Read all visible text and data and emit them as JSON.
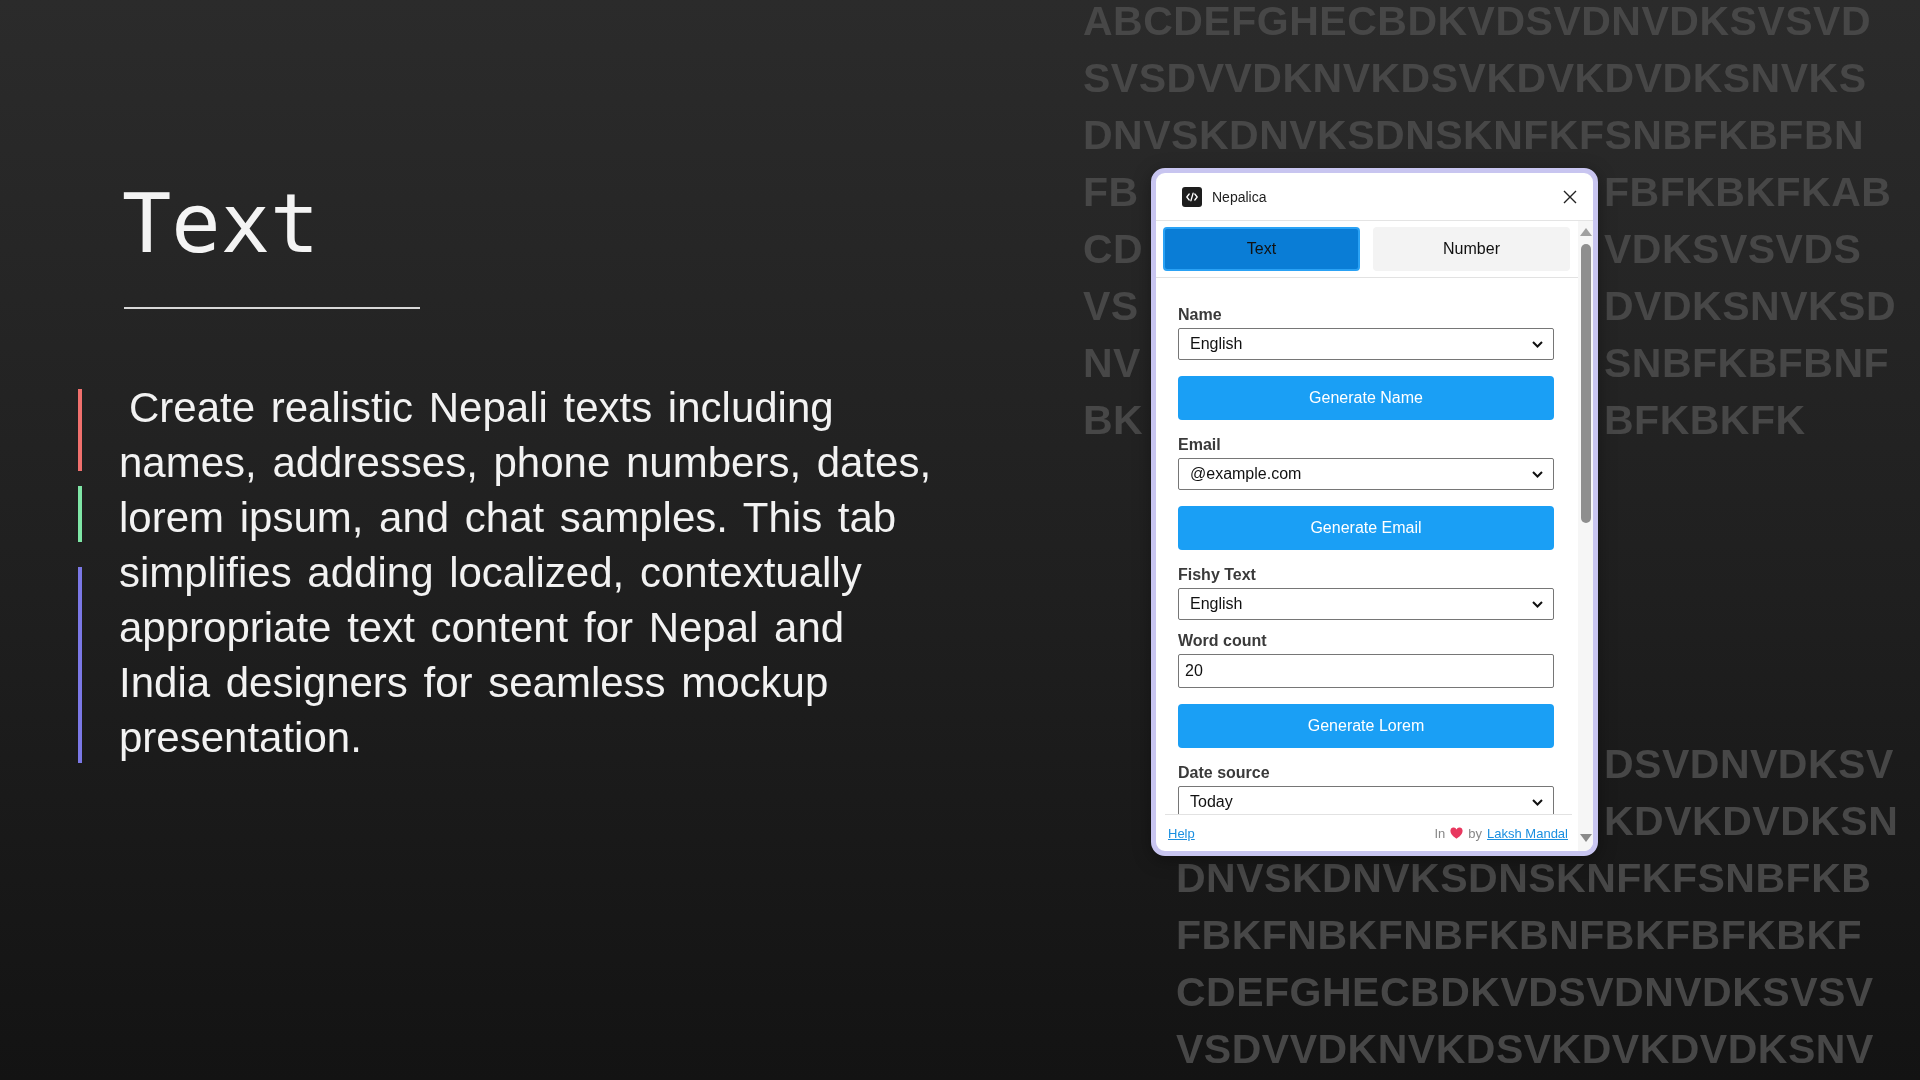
{
  "slide": {
    "title": "Text",
    "description": "Create realistic Nepali texts including names, addresses, phone numbers, dates, lorem ipsum, and chat samples. This tab simplifies adding localized, contextually appropriate text content for Nepal and India designers for seamless mockup presentation."
  },
  "background_letters": {
    "upper_rows": [
      {
        "text": "ABCDEFGHECBDKVDSVDNVDKSVSVD"
      },
      {
        "text": "SVSDVVDKNVKDSVKDVKDVDKSNVKS"
      },
      {
        "text": "DNVSKDNVKSDNSKNFKFSNBFKBFBN"
      },
      {
        "left": "FB",
        "right": "FBFKBKFKAB"
      },
      {
        "left": "CD",
        "right": "VDKSVSVDS"
      },
      {
        "left": "VS",
        "right": "DVDKSNVKSD"
      },
      {
        "left": "NV",
        "right": "SNBFKBFBNF"
      },
      {
        "left": "BK",
        "right": "BFKBKFK"
      }
    ],
    "lower_rows": [
      {
        "right": "DSVDNVDKSV"
      },
      {
        "right": "KDVKDVDKSN"
      },
      {
        "text": "DNVSKDNVKSDNSKNFKFSNBFKB"
      },
      {
        "text": "FBKFNBKFNBFKBNFBKFBFKBKF"
      },
      {
        "text": "CDEFGHECBDKVDSVDNVDKSVSV"
      },
      {
        "text": "VSDVVDKNVKDSVKDVKDVDKSNV"
      }
    ]
  },
  "window": {
    "title": "Nepalica"
  },
  "tabs": [
    {
      "label": "Text",
      "selected": true
    },
    {
      "label": "Number",
      "selected": false
    }
  ],
  "controls": [
    {
      "kind": "select",
      "label": "Name",
      "value": "English"
    },
    {
      "kind": "button",
      "label": "Generate Name"
    },
    {
      "kind": "select",
      "label": "Email",
      "value": "@example.com"
    },
    {
      "kind": "button",
      "label": "Generate Email"
    },
    {
      "kind": "select",
      "label": "Fishy Text",
      "value": "English"
    },
    {
      "kind": "input",
      "label": "Word count",
      "value": "20"
    },
    {
      "kind": "button",
      "label": "Generate Lorem"
    },
    {
      "kind": "select",
      "label": "Date source",
      "value": "Today"
    }
  ],
  "footer": {
    "help_link": "Help",
    "credit_prefix": "In",
    "credit_by": "by",
    "author_link": "Laksh Mandal"
  }
}
